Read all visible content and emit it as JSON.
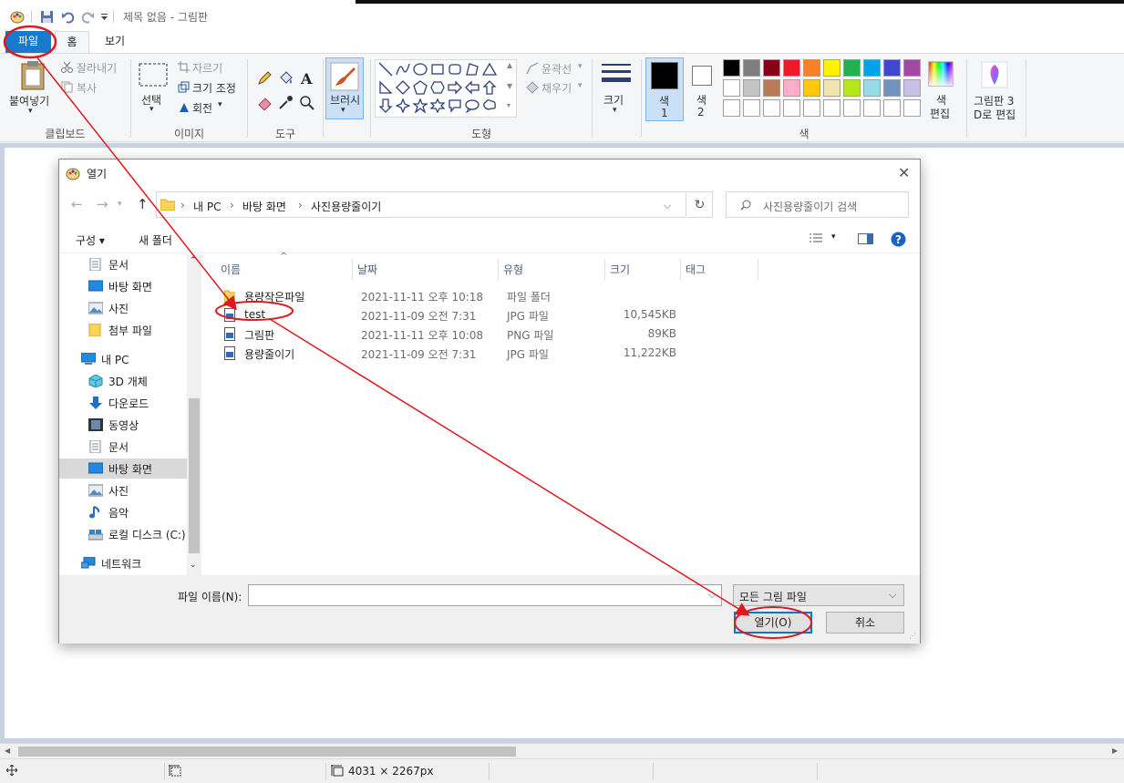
{
  "app": {
    "title": "제목 없음 - 그림판"
  },
  "tabs": {
    "file": "파일",
    "home": "홈",
    "view": "보기"
  },
  "ribbon": {
    "clipboard": {
      "paste": "붙여넣기",
      "cut": "잘라내기",
      "copy": "복사",
      "group": "클립보드"
    },
    "image": {
      "select": "선택",
      "crop": "자르기",
      "resize": "크기 조정",
      "rotate": "회전",
      "group": "이미지"
    },
    "tools": {
      "group": "도구"
    },
    "brushes": {
      "label": "브러시"
    },
    "shapes": {
      "outline": "윤곽선",
      "fill": "채우기",
      "group": "도형"
    },
    "size": {
      "label": "크기"
    },
    "colors": {
      "color1_a": "색",
      "color1_b": "1",
      "color2_a": "색",
      "color2_b": "2",
      "edit_a": "색",
      "edit_b": "편집",
      "group": "색",
      "palette_row1": [
        "#000000",
        "#7f7f7f",
        "#880015",
        "#ed1c24",
        "#ff7f27",
        "#fff200",
        "#22b14c",
        "#00a2e8",
        "#3f48cc",
        "#a349a4"
      ],
      "palette_row2": [
        "#ffffff",
        "#c3c3c3",
        "#b97a57",
        "#ffaec9",
        "#ffc90e",
        "#efe4b0",
        "#b5e61d",
        "#99d9ea",
        "#7092be",
        "#c8bfe7"
      ]
    },
    "paint3d": {
      "line1": "그림판 3",
      "line2": "D로 편집"
    }
  },
  "statusbar": {
    "dimensions": "4031 × 2267px"
  },
  "dialog": {
    "title": "열기",
    "breadcrumb": [
      "내 PC",
      "바탕 화면",
      "사진용량줄이기"
    ],
    "search_placeholder": "사진용량줄이기 검색",
    "organize": "구성 ▾",
    "new_folder": "새 폴더",
    "nav": {
      "documents_top": "문서",
      "desktop_top": "바탕 화면",
      "pictures_top": "사진",
      "attachments": "첨부 파일",
      "this_pc": "내 PC",
      "objects3d": "3D 개체",
      "downloads": "다운로드",
      "videos": "동영상",
      "documents": "문서",
      "desktop": "바탕 화면",
      "pictures": "사진",
      "music": "음악",
      "local_disk": "로컬 디스크 (C:)",
      "network": "네트워크"
    },
    "columns": {
      "name": "이름",
      "date": "날짜",
      "type": "유형",
      "size": "크기",
      "tags": "태그"
    },
    "files": [
      {
        "name": "용량작은파일",
        "date": "2021-11-11 오후 10:18",
        "type": "파일 폴더",
        "size": ""
      },
      {
        "name": "test",
        "date": "2021-11-09 오전 7:31",
        "type": "JPG 파일",
        "size": "10,545KB"
      },
      {
        "name": "그림판",
        "date": "2021-11-11 오후 10:08",
        "type": "PNG 파일",
        "size": "89KB"
      },
      {
        "name": "용량줄이기",
        "date": "2021-11-09 오전 7:31",
        "type": "JPG 파일",
        "size": "11,222KB"
      }
    ],
    "filename_label": "파일 이름(N):",
    "filename_value": "",
    "filetype": "모든 그림 파일",
    "open_button": "열기(O)",
    "cancel_button": "취소"
  },
  "annotation_color": "#e0191e"
}
